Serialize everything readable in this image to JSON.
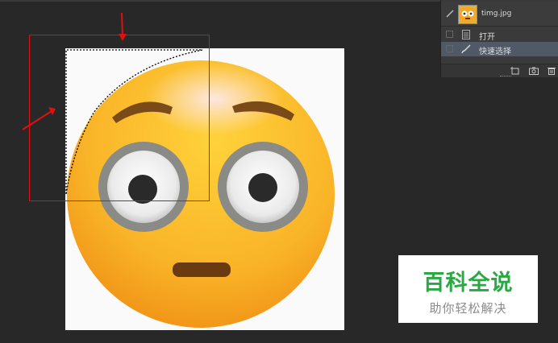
{
  "history_panel": {
    "snapshot_name": "timg.jpg",
    "states": [
      {
        "label": "打开",
        "icon": "document-icon",
        "selected": false
      },
      {
        "label": "快速选择",
        "icon": "quick-selection-brush-icon",
        "selected": true
      }
    ],
    "footer_icons": [
      "new-document-from-state-icon",
      "camera-icon",
      "trash-icon"
    ]
  },
  "canvas": {
    "image_subject": "flushed-face-emoji-icon",
    "selection_tool": "quick-selection",
    "annotation_color": "#e01010"
  },
  "watermark": {
    "title": "百科全说",
    "subtitle": "助你轻松解决",
    "title_color": "#2aa844"
  }
}
